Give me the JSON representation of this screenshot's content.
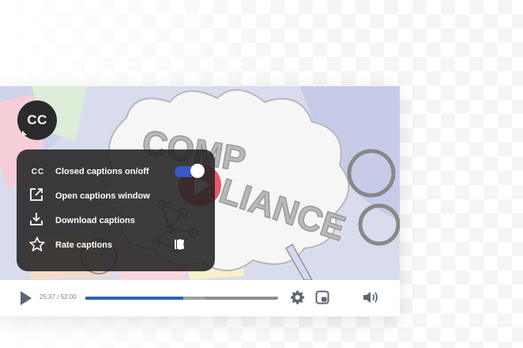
{
  "video": {
    "title_art_text": "COMPLIANCE",
    "theme": {
      "accent": "#3b56c6",
      "progress": "#2d66b0",
      "menu_bg": "#222222",
      "play_red": "#e0102a"
    }
  },
  "cc_button": {
    "label": "CC"
  },
  "captions_menu": {
    "items": [
      {
        "icon": "cc-icon",
        "label": "Closed captions on/off",
        "control": "toggle",
        "toggle_on": true
      },
      {
        "icon": "external-link-icon",
        "label": "Open captions window"
      },
      {
        "icon": "download-icon",
        "label": "Download captions"
      },
      {
        "icon": "star-icon",
        "label": "Rate captions",
        "control": "thumbs"
      }
    ],
    "cc_glyph": "CC"
  },
  "controls": {
    "time": "25:37 / 52:00",
    "progress_played_fraction": 0.51,
    "progress_buffered_fraction": 0.62
  }
}
